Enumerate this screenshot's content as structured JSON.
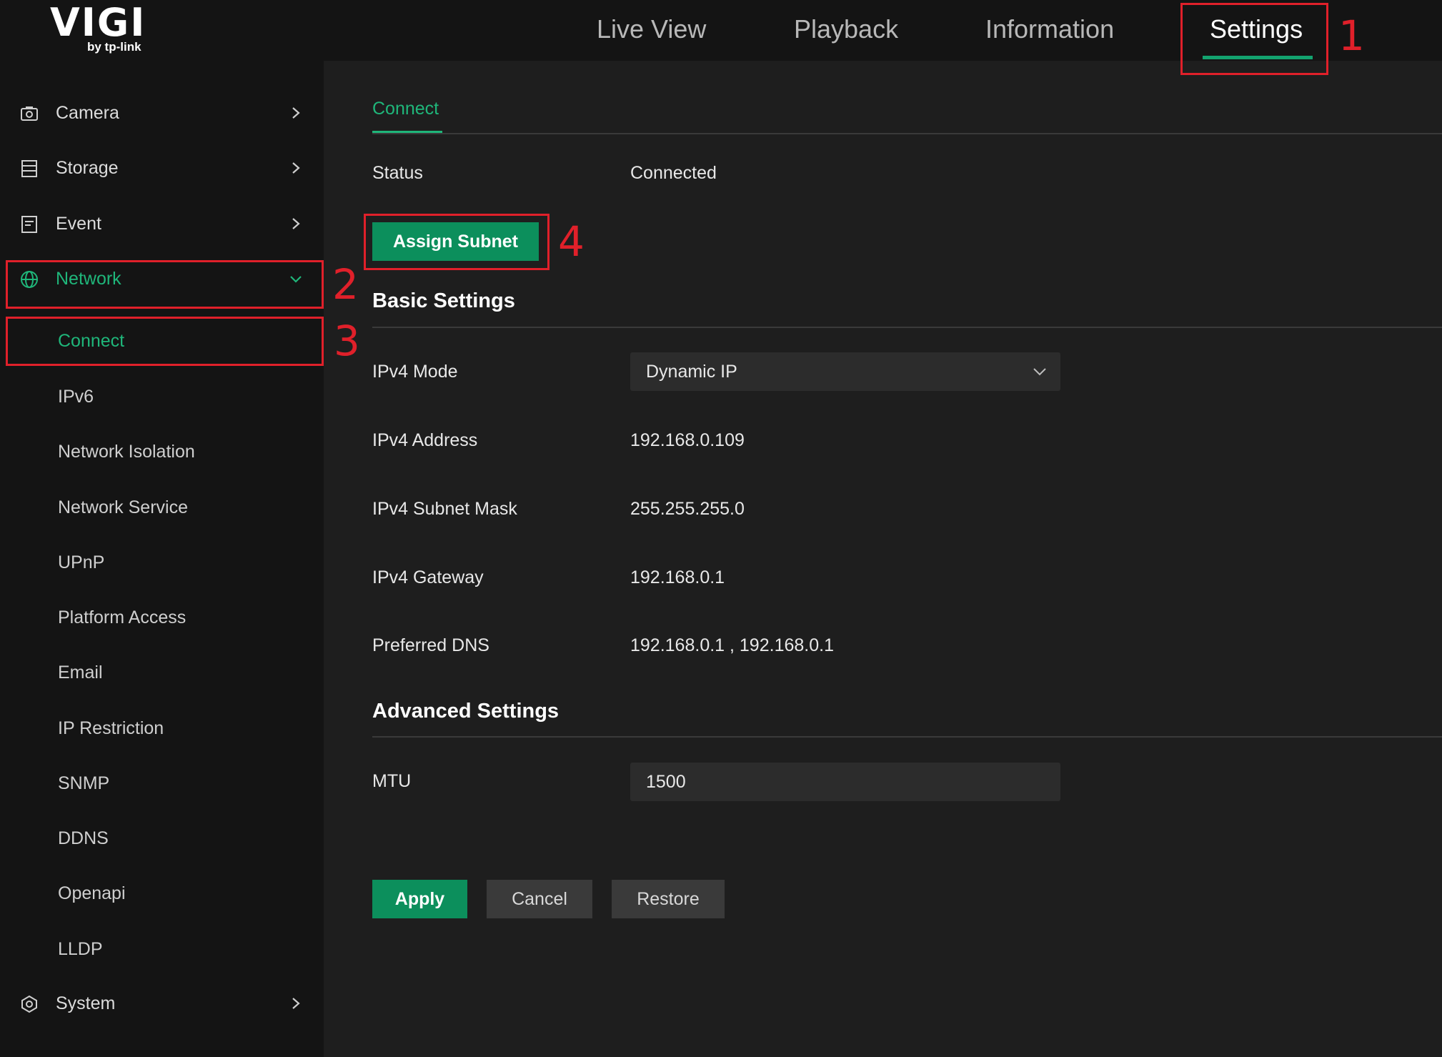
{
  "logo": {
    "main": "VIGI",
    "sub": "by tp-link"
  },
  "top_nav": {
    "tabs": [
      {
        "label": "Live View"
      },
      {
        "label": "Playback"
      },
      {
        "label": "Information"
      },
      {
        "label": "Settings",
        "active": true
      }
    ]
  },
  "sidebar": {
    "items": [
      {
        "label": "Camera",
        "icon": "camera-icon"
      },
      {
        "label": "Storage",
        "icon": "storage-icon"
      },
      {
        "label": "Event",
        "icon": "event-icon"
      },
      {
        "label": "Network",
        "icon": "globe-icon",
        "expanded": true
      },
      {
        "label": "System",
        "icon": "system-icon"
      }
    ],
    "network_sub": [
      {
        "label": "Connect",
        "active": true
      },
      {
        "label": "IPv6"
      },
      {
        "label": "Network Isolation"
      },
      {
        "label": "Network Service"
      },
      {
        "label": "UPnP"
      },
      {
        "label": "Platform Access"
      },
      {
        "label": "Email"
      },
      {
        "label": "IP Restriction"
      },
      {
        "label": "SNMP"
      },
      {
        "label": "DDNS"
      },
      {
        "label": "Openapi"
      },
      {
        "label": "LLDP"
      }
    ]
  },
  "content": {
    "sub_tab": "Connect",
    "status_label": "Status",
    "status_value": "Connected",
    "assign_subnet": "Assign Subnet",
    "basic_title": "Basic Settings",
    "ipv4_mode_label": "IPv4 Mode",
    "ipv4_mode_value": "Dynamic IP",
    "ipv4_address_label": "IPv4 Address",
    "ipv4_address_value": "192.168.0.109",
    "subnet_label": "IPv4 Subnet Mask",
    "subnet_value": "255.255.255.0",
    "gateway_label": "IPv4 Gateway",
    "gateway_value": "192.168.0.1",
    "dns_label": "Preferred DNS",
    "dns_value": "192.168.0.1 , 192.168.0.1",
    "advanced_title": "Advanced Settings",
    "mtu_label": "MTU",
    "mtu_value": "1500",
    "apply": "Apply",
    "cancel": "Cancel",
    "restore": "Restore"
  },
  "annotations": [
    "1",
    "2",
    "3",
    "4"
  ],
  "colors": {
    "accent": "#1fb67a",
    "primary_button": "#0c8f5c",
    "annotation": "#e0202a"
  }
}
